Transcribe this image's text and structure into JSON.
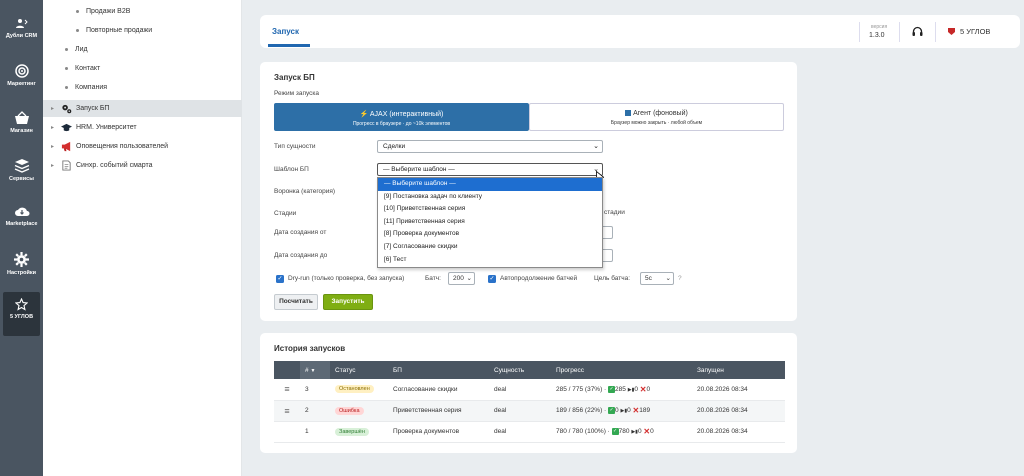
{
  "iconbar": [
    {
      "label": "Дубли CRM",
      "icon": "person-merge-icon"
    },
    {
      "label": "Маркетинг",
      "icon": "target-icon"
    },
    {
      "label": "Магазин",
      "icon": "basket-icon"
    },
    {
      "label": "Сервисы",
      "icon": "layers-icon"
    },
    {
      "label": "Marketplace",
      "icon": "cloud-download-icon"
    },
    {
      "label": "Настройки",
      "icon": "gear-icon"
    },
    {
      "label": "5 УГЛОВ",
      "icon": "star-outline-icon"
    }
  ],
  "tree": [
    "Продажи B2B",
    "Повторные продажи",
    "Лид",
    "Контакт",
    "Компания",
    "Запуск БП",
    "HRM. Университет",
    "Оповещения пользователей",
    "Синхр. событий смарта"
  ],
  "topbar": {
    "tab": "Запуск",
    "version_label": "версия",
    "version": "1.3.0",
    "brand": "5 УГЛОВ"
  },
  "launch": {
    "title": "Запуск БП",
    "mode_label": "Режим запуска",
    "mode_ajax_title": "AJAX (интерактивный)",
    "mode_ajax_sub": "Прогресс в браузере · до ~10k элементов",
    "mode_agent_title": "Агент (фоновый)",
    "mode_agent_sub": "Браузер можно закрыть · любой объем",
    "entity_label": "Тип сущности",
    "entity_value": "Сделки",
    "template_label": "Шаблон БП",
    "template_value": "— Выберите шаблон —",
    "funnel_label": "Воронка (категория)",
    "stages_label": "Стадии",
    "stages_hint": "стадии",
    "date_from_label": "Дата создания от",
    "date_to_label": "Дата создания до",
    "dryrun_label": "Dry-run (только проверка, без запуска)",
    "batch_label": "Батч:",
    "batch_value": "200",
    "autocontinue_label": "Автопродолжение батчей",
    "target_label": "Цель батча:",
    "target_value": "5с",
    "help": "?",
    "count_button": "Посчитать",
    "run_button": "Запустить"
  },
  "dropdown_options": [
    "— Выберите шаблон —",
    "[9] Постановка задач по клиенту",
    "[10] Приветственная серия",
    "[11] Приветственная серия",
    "[8] Проверка документов",
    "[7] Согласование скидки",
    "[6] Тест"
  ],
  "history": {
    "title": "История запусков",
    "columns": [
      "#",
      "Статус",
      "БП",
      "Сущность",
      "Прогресс",
      "Запущен"
    ],
    "rows": [
      {
        "id": "3",
        "status": "Остановлен",
        "bp": "Согласование скидки",
        "entity": "deal",
        "progress": "285 / 775 (37%) ·",
        "ok": "285",
        "skip": "0",
        "err": "0",
        "date": "20.08.2026 08:34"
      },
      {
        "id": "2",
        "status": "Ошибка",
        "bp": "Приветственная серия",
        "entity": "deal",
        "progress": "189 / 856 (22%) ·",
        "ok": "0",
        "skip": "0",
        "err": "189",
        "date": "20.08.2026 08:34"
      },
      {
        "id": "1",
        "status": "Завершён",
        "bp": "Проверка документов",
        "entity": "deal",
        "progress": "780 / 780 (100%) ·",
        "ok": "780",
        "skip": "0",
        "err": "0",
        "date": "20.08.2026 08:34"
      }
    ]
  }
}
